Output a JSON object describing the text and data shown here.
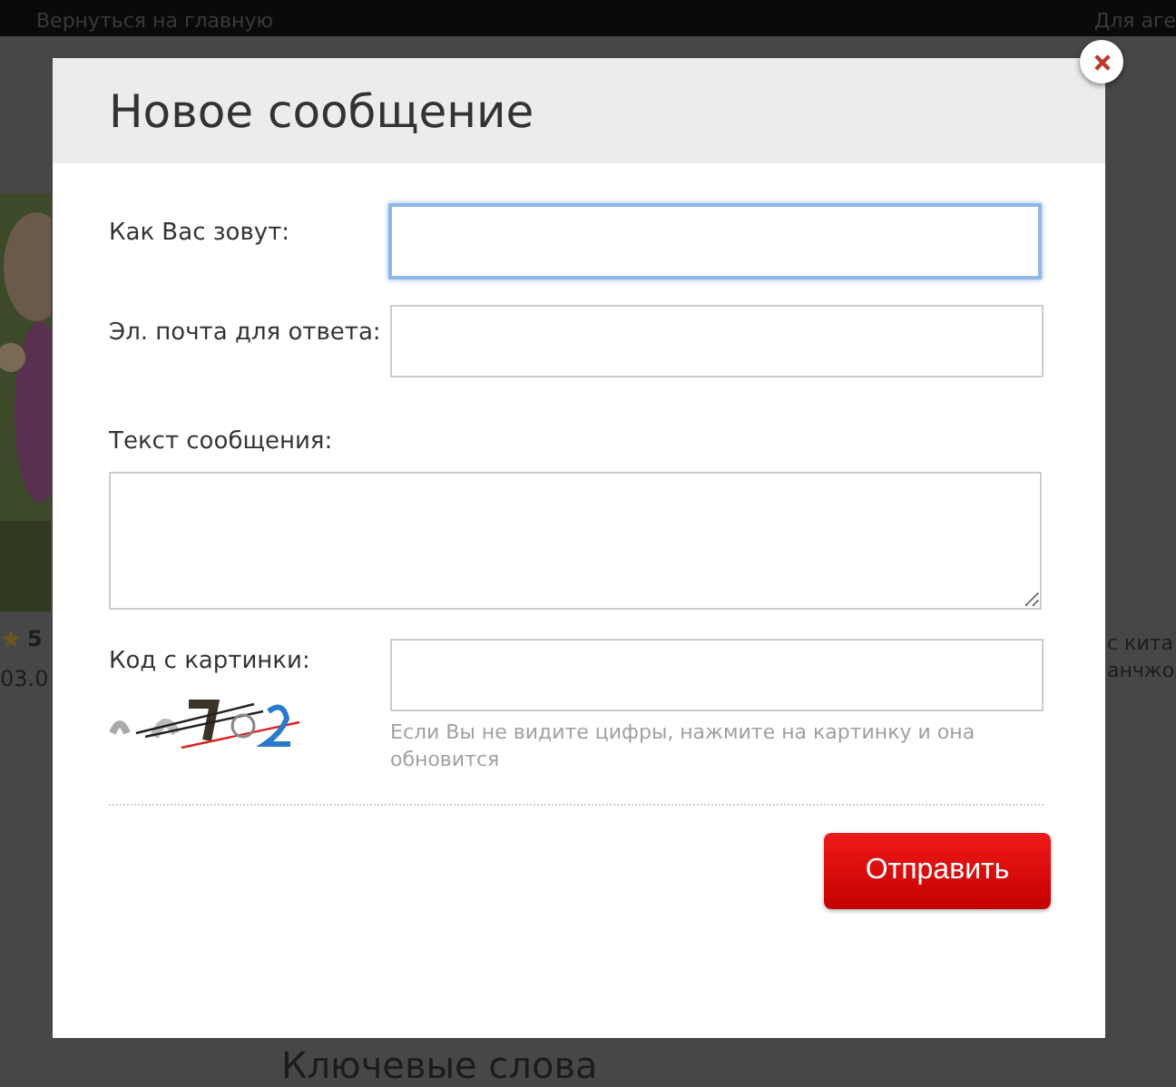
{
  "page": {
    "back_link": "Вернуться на главную",
    "top_right": "Для аге",
    "rating": "5",
    "date": "03.0",
    "side_text": [
      "с кита",
      "анчжо"
    ],
    "section_heading": "Ключевые слова"
  },
  "dialog": {
    "title": "Новое сообщение",
    "fields": [
      {
        "label": "Как Вас зовут:",
        "kind": "input",
        "focused": true
      },
      {
        "label": "Эл. почта для ответа:",
        "kind": "input",
        "focused": false
      },
      {
        "label": "Текст сообщения:",
        "kind": "textarea",
        "focused": false
      },
      {
        "label": "Код с картинки:",
        "kind": "captcha",
        "focused": false,
        "hint": "Если Вы не видите цифры, нажмите на картинку и она обновится"
      }
    ],
    "submit": "Отправить"
  }
}
